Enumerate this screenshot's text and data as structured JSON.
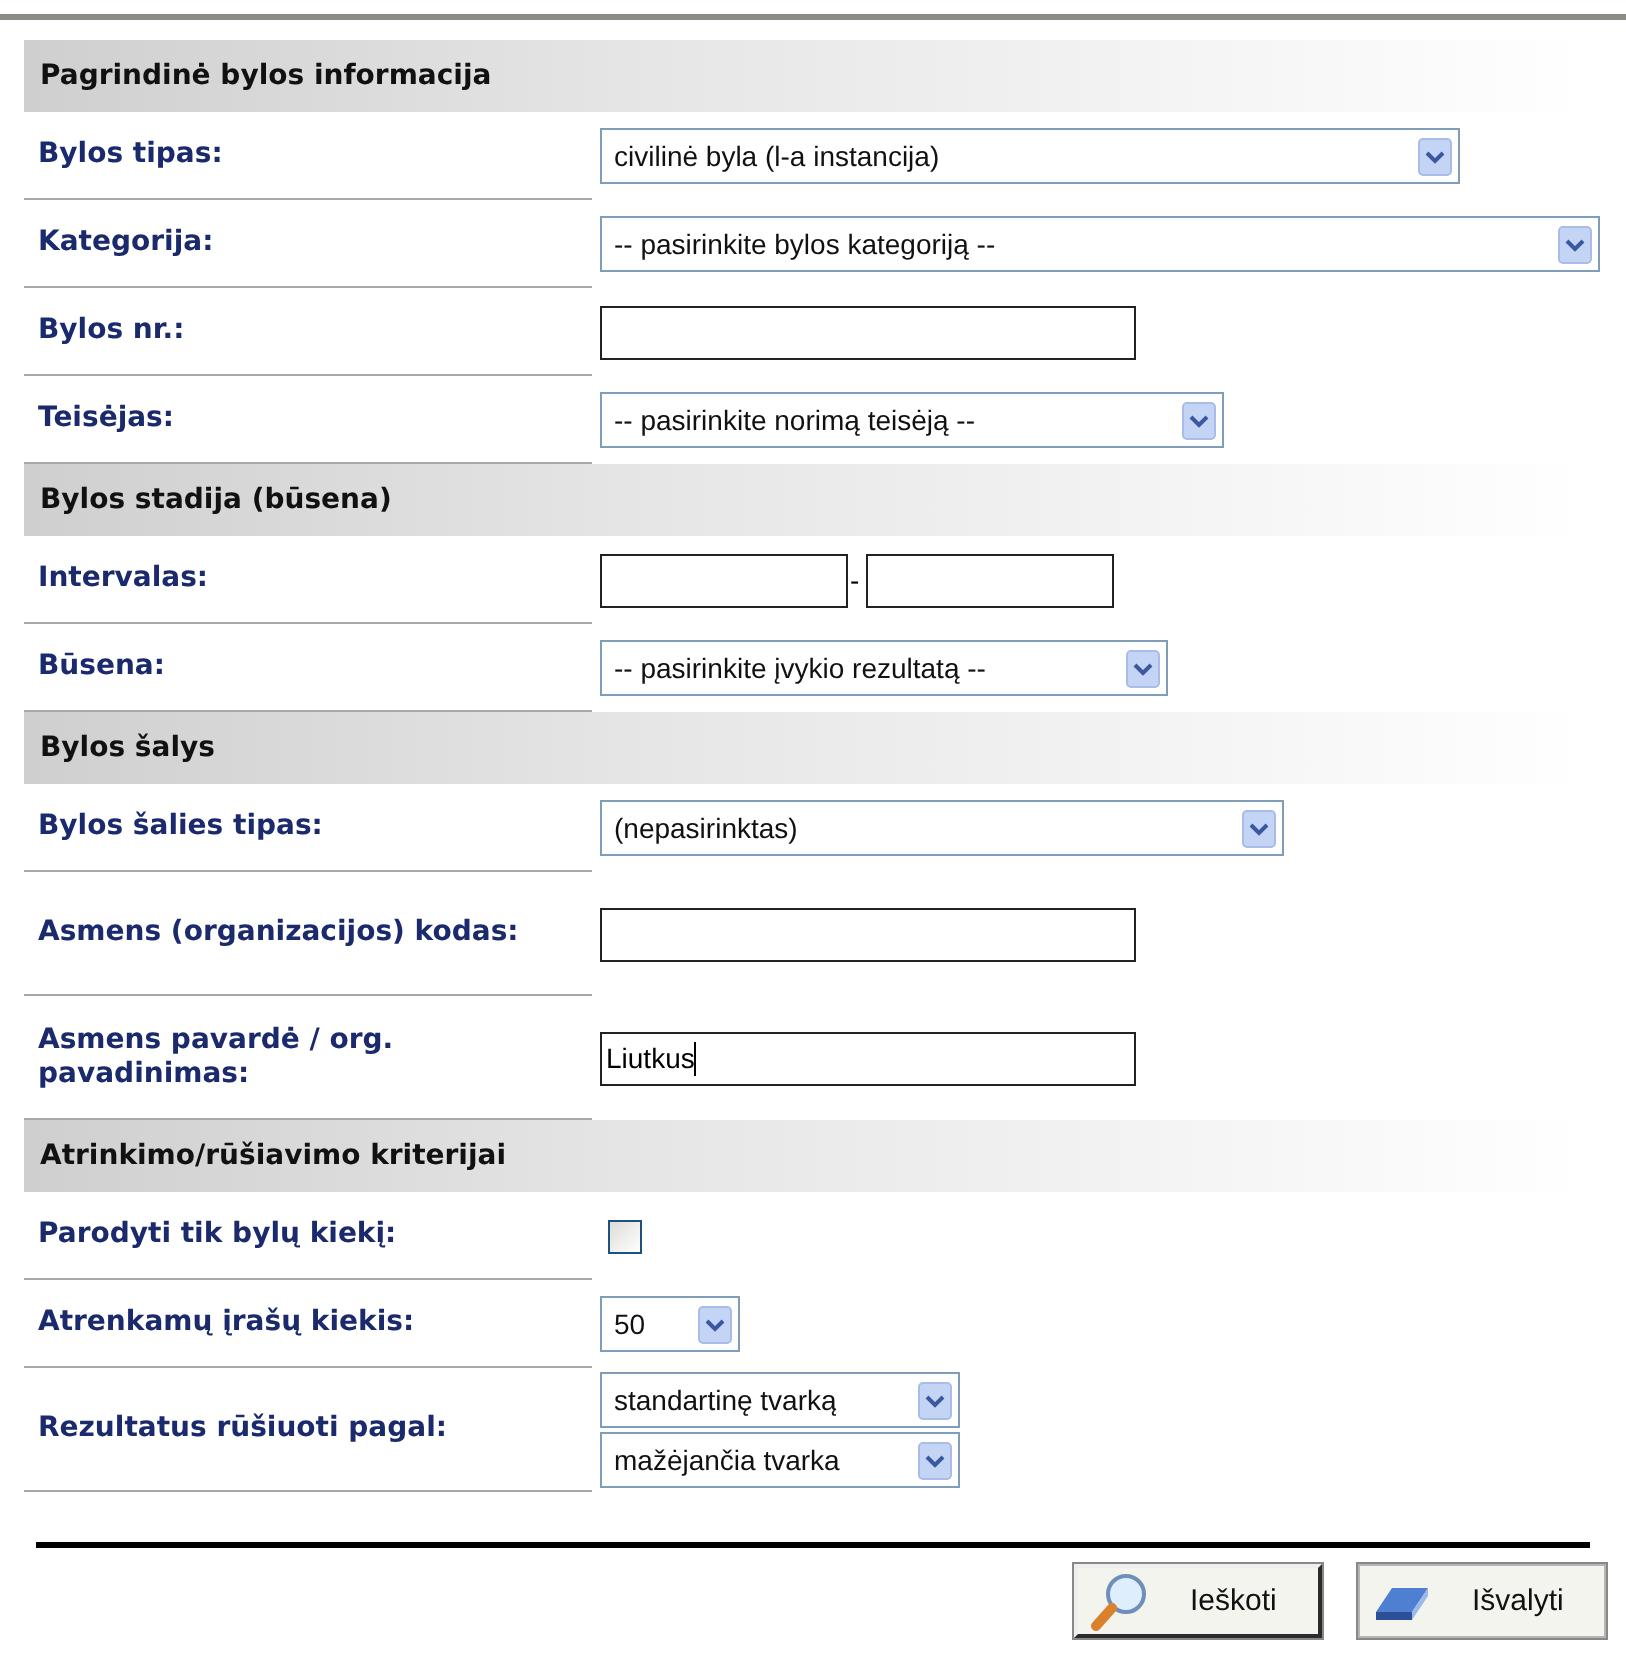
{
  "sections": [
    {
      "title": "Pagrindinė bylos informacija",
      "fields": [
        {
          "kind": "select",
          "label": "Bylos tipas:",
          "value": "civilinė byla (l-a instancija)"
        },
        {
          "kind": "select",
          "label": "Kategorija:",
          "value": "-- pasirinkite bylos kategoriją --"
        },
        {
          "kind": "text",
          "label": "Bylos nr.:"
        },
        {
          "kind": "select",
          "label": "Teisėjas:",
          "value": "-- pasirinkite norimą teisėją --"
        }
      ]
    },
    {
      "title": "Bylos stadija (būsena)",
      "fields": [
        {
          "kind": "range",
          "label": "Intervalas:",
          "separator": "-"
        },
        {
          "kind": "select",
          "label": "Būsena:",
          "value": "-- pasirinkite įvykio rezultatą --"
        }
      ]
    },
    {
      "title": "Bylos šalys",
      "fields": [
        {
          "kind": "select",
          "label": "Bylos šalies tipas:",
          "value": "(nepasirinktas)"
        },
        {
          "kind": "text",
          "label": "Asmens (organizacijos) kodas:"
        },
        {
          "kind": "text",
          "label": "Asmens pavardė / org. pavadinimas:",
          "value": "Liutkus"
        }
      ]
    },
    {
      "title": "Atrinkimo/rūšiavimo kriterijai",
      "fields": [
        {
          "kind": "checkbox",
          "label": "Parodyti tik bylų kiekį:",
          "checked": false
        },
        {
          "kind": "select",
          "label": "Atrenkamų įrašų kiekis:",
          "value": "50"
        },
        {
          "kind": "select-pair",
          "label": "Rezultatus rūšiuoti pagal:",
          "values": [
            "standartinę tvarką",
            "mažėjančia tvarka"
          ]
        }
      ]
    }
  ],
  "buttons": [
    {
      "kind": "search",
      "label": "Ieškoti"
    },
    {
      "kind": "clear",
      "label": "Išvalyti"
    }
  ]
}
